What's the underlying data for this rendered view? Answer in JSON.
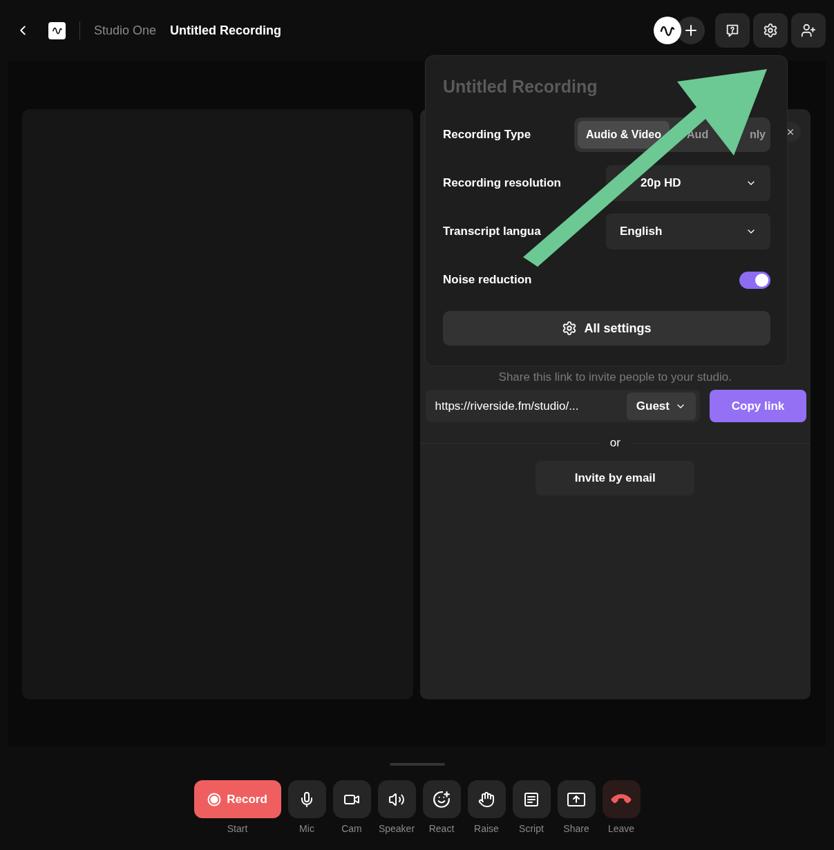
{
  "header": {
    "workspace": "Studio One",
    "title": "Untitled Recording"
  },
  "settings_popover": {
    "title": "Untitled Recording",
    "rows": [
      {
        "kind": "segmented",
        "label": "Recording Type",
        "options": [
          {
            "parts": [
              "Audio & Video"
            ],
            "selected": true
          },
          {
            "parts": [
              "Aud",
              "nly"
            ],
            "selected": false
          }
        ]
      },
      {
        "kind": "select",
        "label": "Recording resolution",
        "value": "20p HD"
      },
      {
        "kind": "select",
        "label": "Transcript langua",
        "value": "English"
      },
      {
        "kind": "toggle",
        "label": "Noise reduction",
        "on": true
      }
    ],
    "all_settings": "All settings"
  },
  "invite": {
    "hint": "Share this link to invite people to your studio.",
    "link": "https://riverside.fm/studio/...",
    "role": "Guest",
    "copy": "Copy link",
    "divider": "or",
    "email": "Invite by email"
  },
  "controls": [
    {
      "kind": "record",
      "label": "Record",
      "caption": "Start"
    },
    {
      "kind": "mic",
      "caption": "Mic"
    },
    {
      "kind": "cam",
      "caption": "Cam"
    },
    {
      "kind": "speaker",
      "caption": "Speaker"
    },
    {
      "kind": "react",
      "caption": "React"
    },
    {
      "kind": "raise",
      "caption": "Raise"
    },
    {
      "kind": "script",
      "caption": "Script"
    },
    {
      "kind": "share",
      "caption": "Share"
    },
    {
      "kind": "leave",
      "caption": "Leave"
    }
  ]
}
